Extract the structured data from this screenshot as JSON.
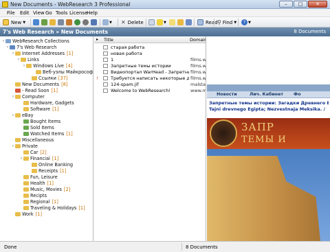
{
  "window": {
    "title": "New Documents - WebResearch 3 Professional"
  },
  "menu": [
    "File",
    "Edit",
    "View",
    "Go",
    "Tools",
    "License",
    "Help"
  ],
  "toolbar": {
    "new_label": "New",
    "delete_label": "Delete",
    "read_label": "Read",
    "find_label": "Find"
  },
  "pathbar": {
    "root": "7's Web Research",
    "separator": "»",
    "current": "New Documents",
    "count": "8 Documents"
  },
  "tree": [
    {
      "label": "WebResearch Collections",
      "count": ""
    },
    {
      "label": "7's Web Research",
      "count": ""
    },
    {
      "label": "Internet Addresses",
      "count": "[1]"
    },
    {
      "label": "Links",
      "count": ""
    },
    {
      "label": "Windows Live",
      "count": "[4]"
    },
    {
      "label": "Веб-узлы Майкрософт",
      "count": "["
    },
    {
      "label": "Ссылки",
      "count": "[37]"
    },
    {
      "label": "New Documents",
      "count": "[8]"
    },
    {
      "label": "- Read Soon",
      "count": "[1]"
    },
    {
      "label": "Computer",
      "count": ""
    },
    {
      "label": "Hardware, Gadgets",
      "count": ""
    },
    {
      "label": "Software",
      "count": "[1]"
    },
    {
      "label": "eBay",
      "count": ""
    },
    {
      "label": "Bought Items",
      "count": ""
    },
    {
      "label": "Sold Items",
      "count": ""
    },
    {
      "label": "Watched Items",
      "count": "[1]"
    },
    {
      "label": "Miscellaneous",
      "count": ""
    },
    {
      "label": "Private",
      "count": ""
    },
    {
      "label": "Car",
      "count": "[2]"
    },
    {
      "label": "Financial",
      "count": "[1]"
    },
    {
      "label": "Online Banking",
      "count": ""
    },
    {
      "label": "Receipts",
      "count": "[1]"
    },
    {
      "label": "Fun, Leisure",
      "count": ""
    },
    {
      "label": "Health",
      "count": "[1]"
    },
    {
      "label": "Music, Movies",
      "count": "[2]"
    },
    {
      "label": "Recipts",
      "count": ""
    },
    {
      "label": "Regional",
      "count": "[1]"
    },
    {
      "label": "Traveling & Holidays",
      "count": "[1]"
    },
    {
      "label": "Work",
      "count": "[1]"
    }
  ],
  "list": {
    "columns": [
      "Title",
      "Domain"
    ],
    "rows": [
      {
        "title": "старая работа",
        "domain": "",
        "flag": ""
      },
      {
        "title": "новая работа",
        "domain": "",
        "flag": ""
      },
      {
        "title": "1",
        "domain": "films.w",
        "flag": ""
      },
      {
        "title": "Запретные темы истории",
        "domain": "films.w",
        "flag": ""
      },
      {
        "title": "Видеопортал WarHead - Запретные те...",
        "domain": "films.w",
        "flag": ""
      },
      {
        "title": "Требуется написать некоторые доработ...",
        "domain": "films.w",
        "flag": "!"
      },
      {
        "title": "124-spam.jif",
        "domain": "malstat",
        "flag": ""
      },
      {
        "title": "Welcome to WebResearch!",
        "domain": "www.m",
        "flag": ""
      }
    ]
  },
  "preview": {
    "nav": [
      "Новости",
      "Лич. Кабинет",
      "Фо"
    ],
    "line1": "Запретные темы истории: Загадки Древнего Египта;",
    "line2": "Tajni drevnego Egipta; Nezvestnaja Meksika. /",
    "banner1": "ЗАПР",
    "banner2": "ТЕМЫ И"
  },
  "status": {
    "left": "Done",
    "right": "8 Documents"
  }
}
